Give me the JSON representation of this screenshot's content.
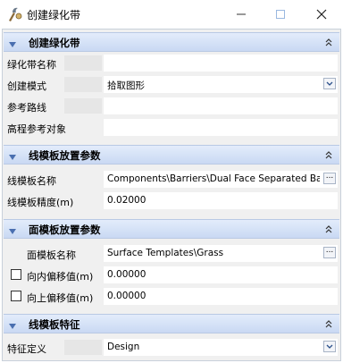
{
  "window": {
    "title": "创建绿化带",
    "app_icon": "tool-icon",
    "buttons": [
      "minimize-icon",
      "maximize-icon",
      "close-icon"
    ]
  },
  "sections": {
    "create": {
      "title": "创建绿化带",
      "rows": {
        "name": {
          "label": "绿化带名称",
          "value": ""
        },
        "mode": {
          "label": "创建模式",
          "value": "拾取图形"
        },
        "path": {
          "label": "参考路线",
          "value": ""
        },
        "elevation": {
          "label": "高程参考对象",
          "value": ""
        }
      }
    },
    "line_template": {
      "title": "线模板放置参数",
      "rows": {
        "name": {
          "label": "线模板名称",
          "value": "Components\\Barriers\\Dual Face Separated Barrier"
        },
        "precision": {
          "label": "线模板精度(m)",
          "value": "0.02000"
        }
      }
    },
    "surface_template": {
      "title": "面模板放置参数",
      "rows": {
        "name": {
          "label": "面模板名称",
          "value": "Surface Templates\\Grass"
        },
        "inward": {
          "label": "向内偏移值(m)",
          "value": "0.00000"
        },
        "upward": {
          "label": "向上偏移值(m)",
          "value": "0.00000"
        }
      }
    },
    "features": {
      "title": "线模板特征",
      "rows": {
        "definition": {
          "label": "特征定义",
          "value": "Design"
        }
      }
    }
  },
  "colors": {
    "header_top": "#e3ecfb",
    "header_bottom": "#c9d9f3",
    "arrow": "#4a6fb0",
    "panel": "#f0f0f0"
  },
  "icons": {
    "section_toggle": "double-chevron-up-icon",
    "section_arrow": "triangle-down-icon",
    "dropdown": "chevron-down-icon",
    "browse": "ellipsis-icon"
  }
}
